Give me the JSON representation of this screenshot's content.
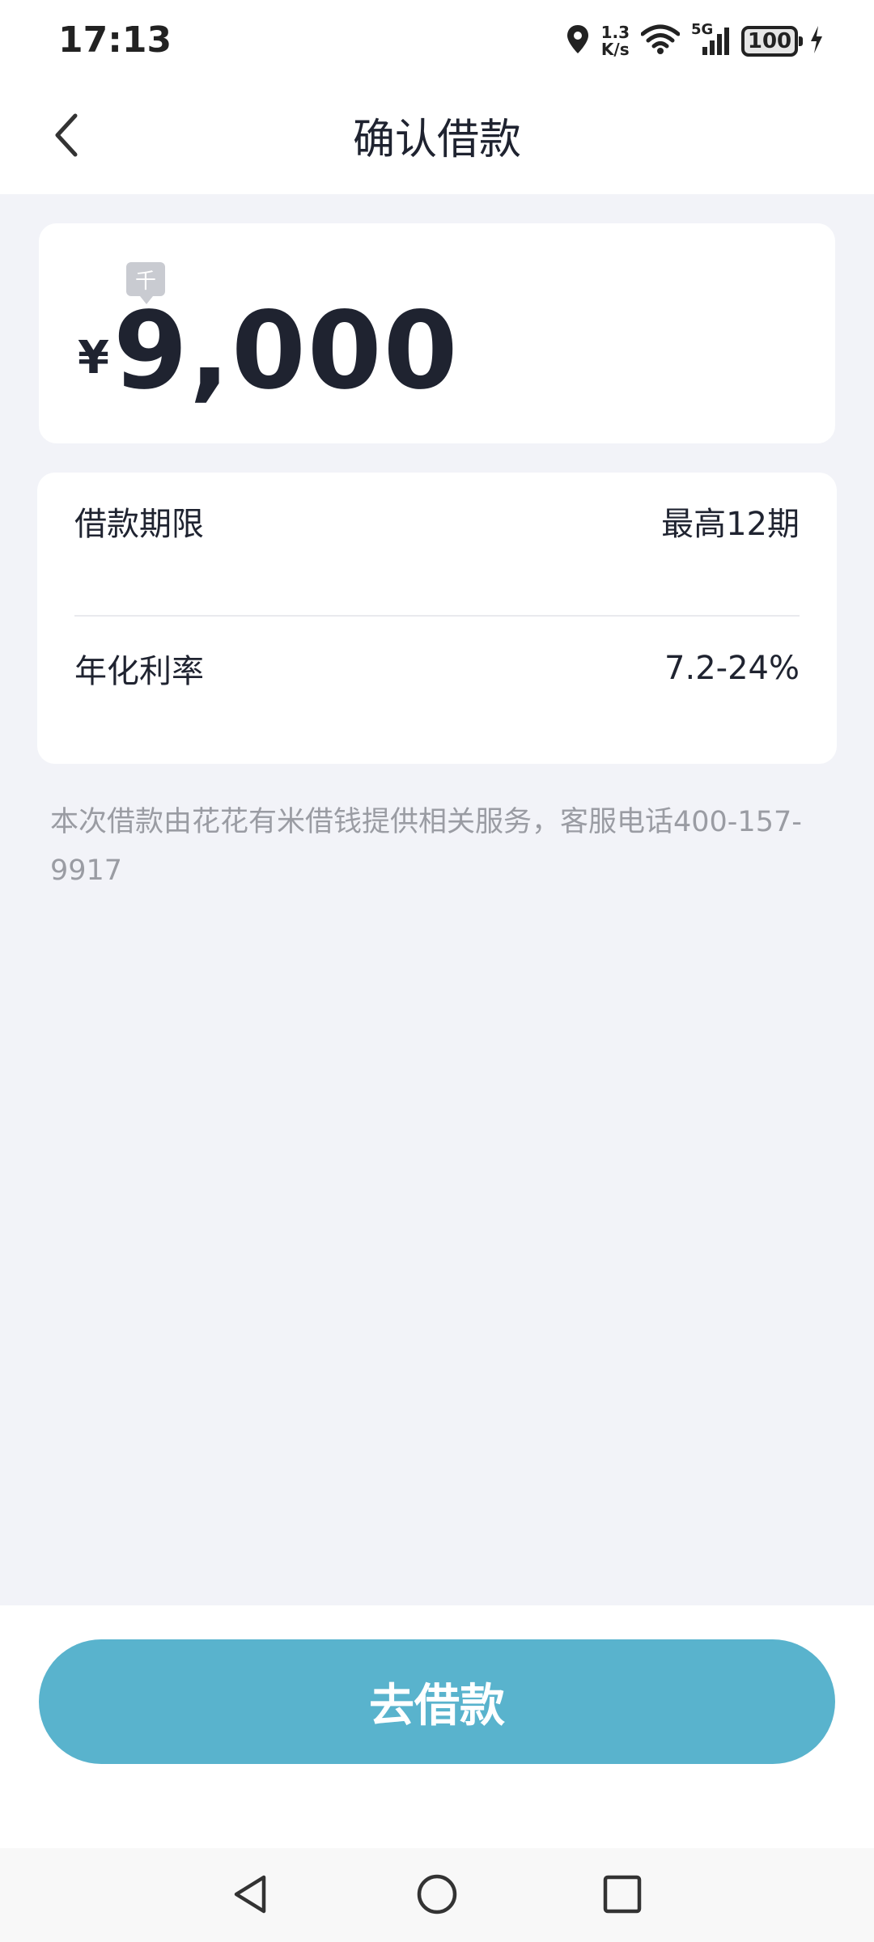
{
  "status_bar": {
    "time": "17:13",
    "net_speed_value": "1.3",
    "net_speed_unit": "K/s",
    "network_type": "5G",
    "battery": "100"
  },
  "nav": {
    "title": "确认借款"
  },
  "amount": {
    "unit_badge": "千",
    "currency": "¥",
    "value": "9,000"
  },
  "info": {
    "rows": [
      {
        "label": "借款期限",
        "value": "最高12期"
      },
      {
        "label": "年化利率",
        "value": "7.2-24%"
      }
    ]
  },
  "disclaimer": "本次借款由花花有米借钱提供相关服务，客服电话400-157-9917",
  "action": {
    "button_label": "去借款",
    "button_color": "#59b3cd"
  },
  "icons": [
    "location-icon",
    "wifi-icon",
    "signal-icon",
    "battery-icon",
    "charging-icon",
    "back-arrow-icon",
    "nav-back-triangle-icon",
    "nav-home-circle-icon",
    "nav-recents-square-icon"
  ]
}
